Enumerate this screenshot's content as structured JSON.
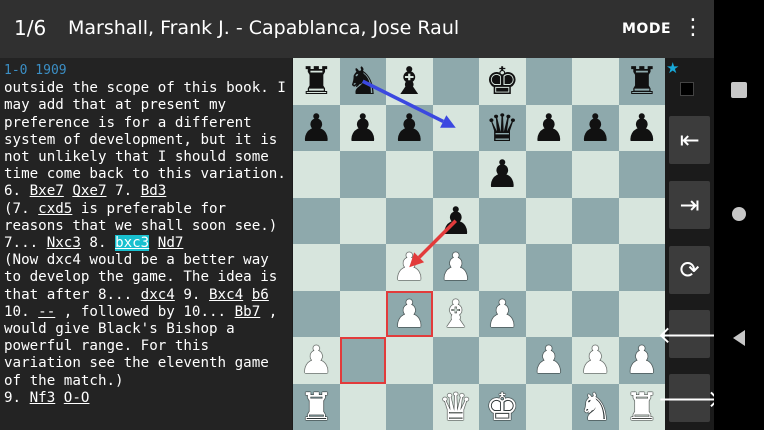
{
  "appbar": {
    "game_number": "1/6",
    "title": "Marshall, Frank J. - Capablanca, Jose Raul",
    "mode_label": "MODE",
    "more_icon": "more-vert-icon"
  },
  "movetext": {
    "header": "1-0 1909",
    "segments": [
      {
        "t": "cmt",
        "s": "outside the scope of this book. I may add that at present my preference is for a different system of development, but it is not unlikely that I should some time come back to this variation."
      },
      {
        "t": "br"
      },
      {
        "t": "num",
        "s": "6. "
      },
      {
        "t": "mv",
        "s": "Bxe7"
      },
      {
        "t": "num",
        "s": " "
      },
      {
        "t": "mv",
        "s": "Qxe7"
      },
      {
        "t": "num",
        "s": " 7. "
      },
      {
        "t": "mv",
        "s": "Bd3"
      },
      {
        "t": "br"
      },
      {
        "t": "cmt",
        "s": "(7. "
      },
      {
        "t": "mv",
        "s": "cxd5"
      },
      {
        "t": "cmt",
        "s": " is preferable for reasons that we shall soon see.)"
      },
      {
        "t": "br"
      },
      {
        "t": "num",
        "s": "7... "
      },
      {
        "t": "mv",
        "s": "Nxc3"
      },
      {
        "t": "num",
        "s": " 8. "
      },
      {
        "t": "mvcur",
        "s": "bxc3"
      },
      {
        "t": "num",
        "s": " "
      },
      {
        "t": "mv",
        "s": "Nd7"
      },
      {
        "t": "br"
      },
      {
        "t": "cmt",
        "s": "(Now dxc4 would be a better way to develop the game. The idea is that after 8... "
      },
      {
        "t": "mv",
        "s": "dxc4"
      },
      {
        "t": "cmt",
        "s": " 9. "
      },
      {
        "t": "mv",
        "s": "Bxc4"
      },
      {
        "t": "cmt",
        "s": " "
      },
      {
        "t": "mv",
        "s": "b6"
      },
      {
        "t": "cmt",
        "s": " 10. "
      },
      {
        "t": "mv",
        "s": "--"
      },
      {
        "t": "cmt",
        "s": " , followed by 10... "
      },
      {
        "t": "mv",
        "s": "Bb7"
      },
      {
        "t": "cmt",
        "s": " , would give Black's Bishop a powerful range. For this variation see the eleventh game of the match.)"
      },
      {
        "t": "br"
      },
      {
        "t": "num",
        "s": "9. "
      },
      {
        "t": "mv",
        "s": "Nf3"
      },
      {
        "t": "num",
        "s": " "
      },
      {
        "t": "mv",
        "s": "O-O"
      }
    ]
  },
  "board": {
    "light_color": "#d7e5dd",
    "dark_color": "#8ea9ac",
    "highlight_color": "#e23b3b",
    "ranks": [
      "rnb.k..r",
      "ppp.qppp",
      "....p...",
      "...p....",
      "..PP....",
      "..PBP...",
      "P....PPP",
      "R..QK.NR"
    ],
    "highlighted_squares": [
      "c3",
      "b2"
    ],
    "arrows": [
      {
        "from": "b8",
        "to": "d7",
        "color": "#3b48e0"
      },
      {
        "from": "d5",
        "to": "c4",
        "color": "#e23b3b"
      }
    ]
  },
  "toolbar": {
    "star_icon": "★",
    "buttons": [
      {
        "name": "prev-variation-button",
        "icon": "variation-back-icon",
        "glyph": "⇤"
      },
      {
        "name": "next-variation-button",
        "icon": "variation-forward-icon",
        "glyph": "⇥"
      },
      {
        "name": "flip-board-button",
        "icon": "cycle-icon",
        "glyph": "⟳"
      },
      {
        "name": "back-button",
        "icon": "arrow-left-icon",
        "glyph": "🡐"
      },
      {
        "name": "forward-button",
        "icon": "arrow-right-icon",
        "glyph": "🡒"
      }
    ]
  }
}
